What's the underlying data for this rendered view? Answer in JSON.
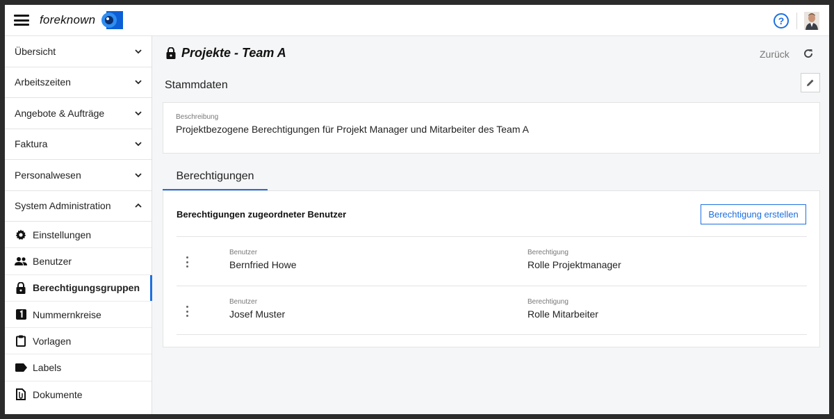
{
  "header": {
    "brand": "foreknown",
    "help_glyph": "?"
  },
  "sidebar": {
    "sections": [
      {
        "label": "Übersicht",
        "expanded": false
      },
      {
        "label": "Arbeitszeiten",
        "expanded": false
      },
      {
        "label": "Angebote & Aufträge",
        "expanded": false
      },
      {
        "label": "Faktura",
        "expanded": false
      },
      {
        "label": "Personalwesen",
        "expanded": false
      },
      {
        "label": "System Administration",
        "expanded": true
      }
    ],
    "subitems": [
      {
        "label": "Einstellungen",
        "icon": "gear-icon"
      },
      {
        "label": "Benutzer",
        "icon": "users-icon"
      },
      {
        "label": "Berechtigungsgruppen",
        "icon": "lock-icon",
        "active": true
      },
      {
        "label": "Nummernkreise",
        "icon": "number-one-icon"
      },
      {
        "label": "Vorlagen",
        "icon": "clipboard-icon"
      },
      {
        "label": "Labels",
        "icon": "label-icon"
      },
      {
        "label": "Dokumente",
        "icon": "document-icon"
      }
    ]
  },
  "page": {
    "title": "Projekte - Team A",
    "back_label": "Zurück",
    "stamm_title": "Stammdaten",
    "description_label": "Beschreibung",
    "description_value": "Projektbezogene Berechtigungen für Projekt Manager und Mitarbeiter des Team A"
  },
  "tabs": {
    "active": "Berechtigungen"
  },
  "permissions": {
    "heading": "Berechtigungen zugeordneter Benutzer",
    "create_label": "Berechtigung erstellen",
    "rows": [
      {
        "user_label": "Benutzer",
        "user": "Bernfried Howe",
        "perm_label": "Berechtigung",
        "perm": "Rolle Projektmanager"
      },
      {
        "user_label": "Benutzer",
        "user": "Josef Muster",
        "perm_label": "Berechtigung",
        "perm": "Rolle Mitarbeiter"
      }
    ]
  },
  "colors": {
    "accent": "#1c6fe0",
    "background": "#f5f6f7"
  }
}
